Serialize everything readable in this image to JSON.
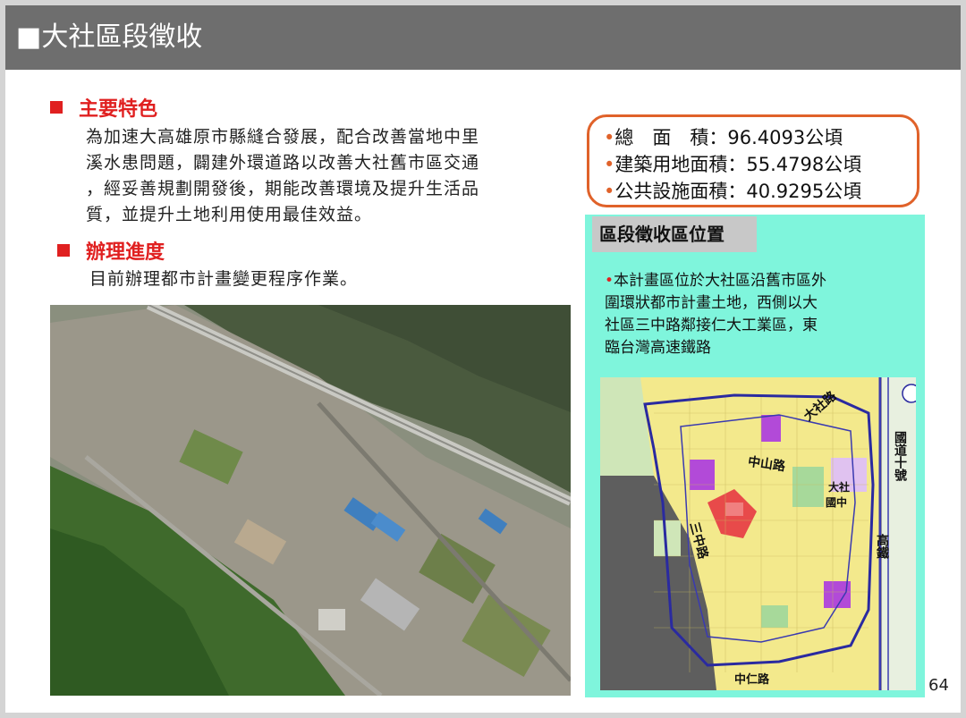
{
  "slide": {
    "title": "■大社區段徵收",
    "page_number": "64"
  },
  "features": {
    "heading": "主要特色",
    "lines": [
      "為加速大高雄原市縣縫合發展，配合改善當地中里",
      "溪水患問題，闢建外環道路以改善大社舊市區交通",
      "，經妥善規劃開發後，期能改善環境及提升生活品",
      "質，並提升土地利用使用最佳效益。"
    ]
  },
  "progress": {
    "heading": "辦理進度",
    "text": "目前辦理都市計畫變更程序作業。"
  },
  "stats": {
    "rows": [
      "總　面　積：96.4093公頃",
      "建築用地面積：55.4798公頃",
      "公共設施面積：40.9295公頃"
    ],
    "accent": "#e0622a"
  },
  "location": {
    "heading": "區段徵收區位置",
    "lines": [
      "本計畫區位於大社區沿舊市區外",
      "圍環狀都市計畫土地，西側以大",
      "社區三中路鄰接仁大工業區，東",
      "臨台灣高速鐵路"
    ],
    "panel_color": "#7ff5dc"
  },
  "map": {
    "labels": {
      "dashe_road": "大社路",
      "zhongshan_road": "中山路",
      "school_1": "大社",
      "school_2": "國中",
      "sanzhong_road": "三中路",
      "zhongren_road": "中仁路",
      "freeway": "國道十號",
      "hsr": "高鐵"
    }
  },
  "colors": {
    "title_bar": "#6e6e6e",
    "heading_red": "#e02020"
  }
}
